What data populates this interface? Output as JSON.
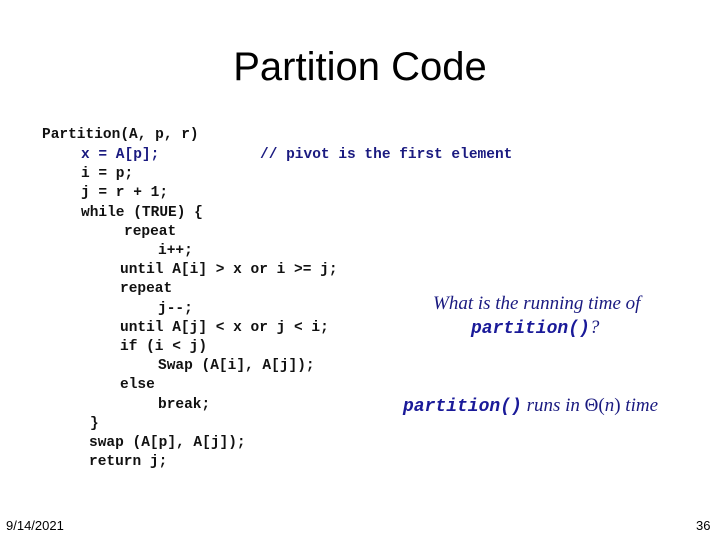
{
  "slide": {
    "title": "Partition Code",
    "date": "9/14/2021",
    "page_number": "36"
  },
  "code": {
    "lines": [
      "Partition(A, p, r)",
      "x = A[p];",
      "i = p;",
      "j = r + 1;",
      "while (TRUE) {",
      "repeat",
      "i++;",
      "until A[i] > x or i >= j;",
      "repeat",
      "j--;",
      "until A[j] < x or j < i;",
      "if (i < j)",
      "Swap (A[i], A[j]);",
      "else",
      "break;",
      "}",
      "swap (A[p], A[j]);",
      "return j;"
    ],
    "comment": "// pivot is the first element"
  },
  "notes": {
    "question_prefix": "What is the running time of",
    "question_func": "partition()",
    "question_suffix": "?",
    "answer_func": "partition()",
    "answer_mid": " runs in ",
    "answer_theta": "Θ(",
    "answer_n": "n",
    "answer_close": ")",
    "answer_suffix": " time"
  },
  "colors": {
    "code_text": "#111111",
    "accent_navy": "#1a1a80"
  }
}
